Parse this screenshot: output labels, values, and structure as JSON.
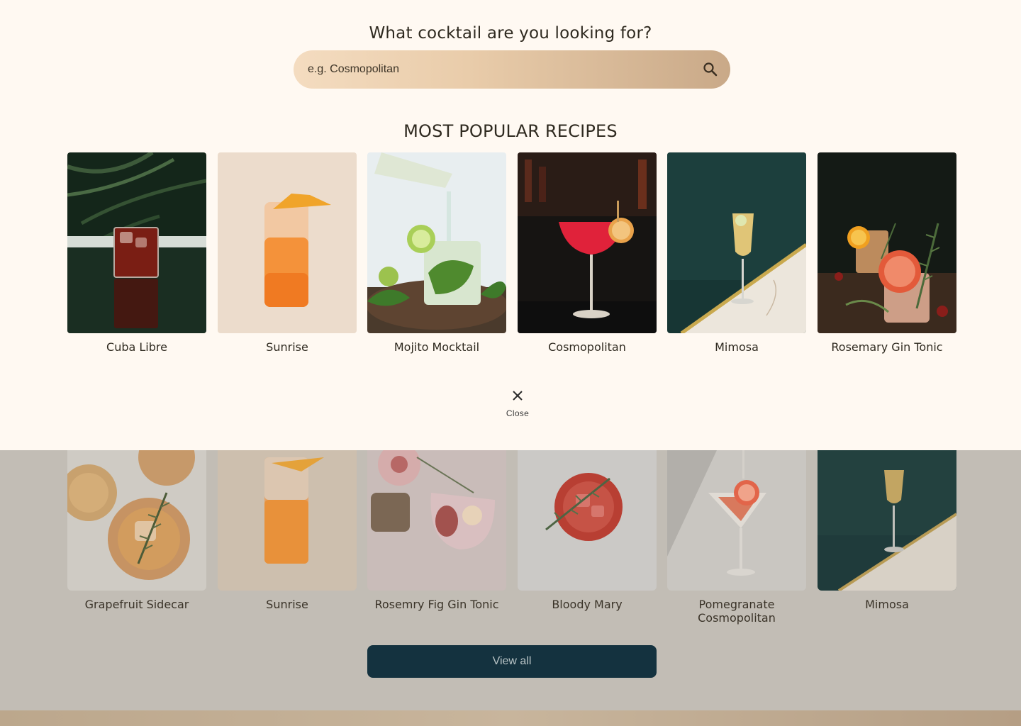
{
  "overlay": {
    "search_title": "What cocktail are you looking for?",
    "search_placeholder": "e.g. Cosmopolitan",
    "search_icon": "search-icon",
    "section_title": "MOST POPULAR RECIPES",
    "recipes": [
      {
        "name": "Cuba Libre"
      },
      {
        "name": "Sunrise"
      },
      {
        "name": "Mojito Mocktail"
      },
      {
        "name": "Cosmopolitan"
      },
      {
        "name": "Mimosa"
      },
      {
        "name": "Rosemary Gin Tonic"
      }
    ],
    "close_icon": "close-icon",
    "close_label": "Close"
  },
  "background": {
    "recipes": [
      {
        "name": "Grapefruit Sidecar"
      },
      {
        "name": "Sunrise"
      },
      {
        "name": "Rosemry Fig Gin Tonic"
      },
      {
        "name": "Bloody Mary"
      },
      {
        "name": "Pomegranate Cosmopolitan"
      },
      {
        "name": "Mimosa"
      }
    ],
    "view_all_label": "View all"
  },
  "colors": {
    "panel_bg": "#fff9f2",
    "dimmed_bg": "#c2bdb5",
    "button_bg": "#14323f",
    "search_gradient_start": "#f4dcc0",
    "search_gradient_end": "#c9a988"
  }
}
